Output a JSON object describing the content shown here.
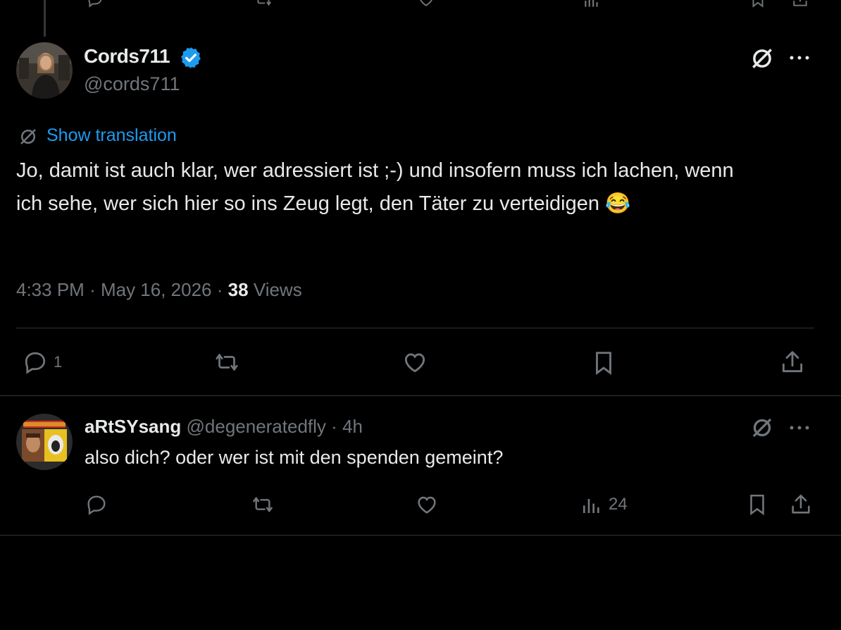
{
  "main_tweet": {
    "display_name": "Cords711",
    "handle": "@cords711",
    "show_translation": "Show translation",
    "text": "Jo, damit ist auch klar, wer adressiert ist ;-) und insofern muss ich lachen, wenn ich sehe, wer sich hier so ins Zeug legt, den Täter zu verteidigen 😂",
    "time": "4:33 PM",
    "dot1": "·",
    "date": "May 16, 2026",
    "dot2": "·",
    "views_count": "38",
    "views_label": "Views",
    "reply_count": "1"
  },
  "reply_tweet": {
    "display_name": "aRtSYsang",
    "handle": "@degeneratedfly",
    "dot": "·",
    "age": "4h",
    "text": "also dich? oder wer ist mit den spenden gemeint?",
    "views_count": "24"
  },
  "colors": {
    "background": "#000000",
    "text": "#e7e9ea",
    "muted": "#71767b",
    "link": "#1d9bf0",
    "verified": "#1d9bf0",
    "divider": "#2f3336"
  }
}
